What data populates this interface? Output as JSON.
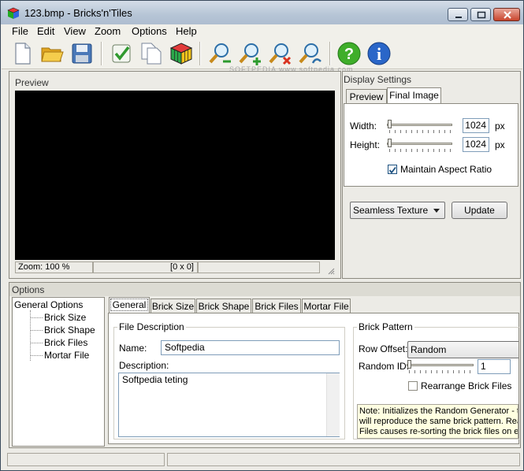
{
  "window": {
    "title": "123.bmp - Bricks'n'Tiles"
  },
  "menu": [
    "File",
    "Edit",
    "View",
    "Zoom",
    "Options",
    "Help"
  ],
  "toolbar_icons": [
    "new-file-icon",
    "open-folder-icon",
    "save-disk-icon",
    "check-icon",
    "copy-pages-icon",
    "cube-icon",
    "zoom-out-icon",
    "zoom-in-icon",
    "zoom-cancel-icon",
    "zoom-fit-icon",
    "help-icon",
    "info-icon"
  ],
  "watermark": "SOFTPEDIA www.softpedia.com",
  "preview": {
    "title": "Preview",
    "status_zoom": "Zoom: 100 %",
    "status_coords": "[0 x 0]"
  },
  "display_settings": {
    "title": "Display Settings",
    "tabs": [
      "Preview",
      "Final Image"
    ],
    "active_tab": "Final Image",
    "width_label": "Width:",
    "width_value": "1024",
    "height_label": "Height:",
    "height_value": "1024",
    "unit": "px",
    "maintain_aspect_label": "Maintain Aspect Ratio",
    "maintain_aspect_checked": true,
    "texture_mode": "Seamless Texture",
    "update_label": "Update"
  },
  "options": {
    "title": "Options",
    "tree_root": "General Options",
    "tree_children": [
      "Brick Size",
      "Brick Shape",
      "Brick Files",
      "Mortar File"
    ],
    "tabs": [
      "General",
      "Brick Size",
      "Brick Shape",
      "Brick Files",
      "Mortar File"
    ],
    "active_tab": "General",
    "file_description": {
      "title": "File Description",
      "name_label": "Name:",
      "name_value": "Softpedia",
      "description_label": "Description:",
      "description_value": "Softpedia teting"
    },
    "brick_pattern": {
      "title": "Brick Pattern",
      "row_offset_label": "Row Offset:",
      "row_offset_value": "Random",
      "random_id_label": "Random ID:",
      "random_id_value": "1",
      "rearrange_label": "Rearrange Brick Files",
      "rearrange_checked": false
    },
    "note_lines": [
      "Note: Initializes the Random Generator - th",
      "will reproduce the same brick pattern. Rear",
      "Files causes re-sorting the brick files on ea"
    ]
  }
}
